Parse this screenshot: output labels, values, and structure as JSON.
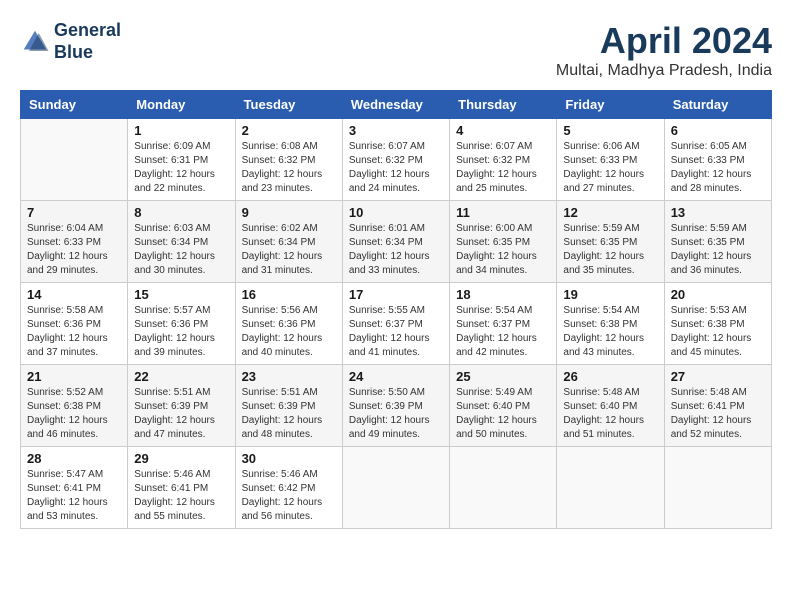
{
  "header": {
    "logo_line1": "General",
    "logo_line2": "Blue",
    "month_year": "April 2024",
    "location": "Multai, Madhya Pradesh, India"
  },
  "weekdays": [
    "Sunday",
    "Monday",
    "Tuesday",
    "Wednesday",
    "Thursday",
    "Friday",
    "Saturday"
  ],
  "weeks": [
    [
      null,
      {
        "day": 1,
        "sunrise": "6:09 AM",
        "sunset": "6:31 PM",
        "daylight": "12 hours and 22 minutes."
      },
      {
        "day": 2,
        "sunrise": "6:08 AM",
        "sunset": "6:32 PM",
        "daylight": "12 hours and 23 minutes."
      },
      {
        "day": 3,
        "sunrise": "6:07 AM",
        "sunset": "6:32 PM",
        "daylight": "12 hours and 24 minutes."
      },
      {
        "day": 4,
        "sunrise": "6:07 AM",
        "sunset": "6:32 PM",
        "daylight": "12 hours and 25 minutes."
      },
      {
        "day": 5,
        "sunrise": "6:06 AM",
        "sunset": "6:33 PM",
        "daylight": "12 hours and 27 minutes."
      },
      {
        "day": 6,
        "sunrise": "6:05 AM",
        "sunset": "6:33 PM",
        "daylight": "12 hours and 28 minutes."
      }
    ],
    [
      {
        "day": 7,
        "sunrise": "6:04 AM",
        "sunset": "6:33 PM",
        "daylight": "12 hours and 29 minutes."
      },
      {
        "day": 8,
        "sunrise": "6:03 AM",
        "sunset": "6:34 PM",
        "daylight": "12 hours and 30 minutes."
      },
      {
        "day": 9,
        "sunrise": "6:02 AM",
        "sunset": "6:34 PM",
        "daylight": "12 hours and 31 minutes."
      },
      {
        "day": 10,
        "sunrise": "6:01 AM",
        "sunset": "6:34 PM",
        "daylight": "12 hours and 33 minutes."
      },
      {
        "day": 11,
        "sunrise": "6:00 AM",
        "sunset": "6:35 PM",
        "daylight": "12 hours and 34 minutes."
      },
      {
        "day": 12,
        "sunrise": "5:59 AM",
        "sunset": "6:35 PM",
        "daylight": "12 hours and 35 minutes."
      },
      {
        "day": 13,
        "sunrise": "5:59 AM",
        "sunset": "6:35 PM",
        "daylight": "12 hours and 36 minutes."
      }
    ],
    [
      {
        "day": 14,
        "sunrise": "5:58 AM",
        "sunset": "6:36 PM",
        "daylight": "12 hours and 37 minutes."
      },
      {
        "day": 15,
        "sunrise": "5:57 AM",
        "sunset": "6:36 PM",
        "daylight": "12 hours and 39 minutes."
      },
      {
        "day": 16,
        "sunrise": "5:56 AM",
        "sunset": "6:36 PM",
        "daylight": "12 hours and 40 minutes."
      },
      {
        "day": 17,
        "sunrise": "5:55 AM",
        "sunset": "6:37 PM",
        "daylight": "12 hours and 41 minutes."
      },
      {
        "day": 18,
        "sunrise": "5:54 AM",
        "sunset": "6:37 PM",
        "daylight": "12 hours and 42 minutes."
      },
      {
        "day": 19,
        "sunrise": "5:54 AM",
        "sunset": "6:38 PM",
        "daylight": "12 hours and 43 minutes."
      },
      {
        "day": 20,
        "sunrise": "5:53 AM",
        "sunset": "6:38 PM",
        "daylight": "12 hours and 45 minutes."
      }
    ],
    [
      {
        "day": 21,
        "sunrise": "5:52 AM",
        "sunset": "6:38 PM",
        "daylight": "12 hours and 46 minutes."
      },
      {
        "day": 22,
        "sunrise": "5:51 AM",
        "sunset": "6:39 PM",
        "daylight": "12 hours and 47 minutes."
      },
      {
        "day": 23,
        "sunrise": "5:51 AM",
        "sunset": "6:39 PM",
        "daylight": "12 hours and 48 minutes."
      },
      {
        "day": 24,
        "sunrise": "5:50 AM",
        "sunset": "6:39 PM",
        "daylight": "12 hours and 49 minutes."
      },
      {
        "day": 25,
        "sunrise": "5:49 AM",
        "sunset": "6:40 PM",
        "daylight": "12 hours and 50 minutes."
      },
      {
        "day": 26,
        "sunrise": "5:48 AM",
        "sunset": "6:40 PM",
        "daylight": "12 hours and 51 minutes."
      },
      {
        "day": 27,
        "sunrise": "5:48 AM",
        "sunset": "6:41 PM",
        "daylight": "12 hours and 52 minutes."
      }
    ],
    [
      {
        "day": 28,
        "sunrise": "5:47 AM",
        "sunset": "6:41 PM",
        "daylight": "12 hours and 53 minutes."
      },
      {
        "day": 29,
        "sunrise": "5:46 AM",
        "sunset": "6:41 PM",
        "daylight": "12 hours and 55 minutes."
      },
      {
        "day": 30,
        "sunrise": "5:46 AM",
        "sunset": "6:42 PM",
        "daylight": "12 hours and 56 minutes."
      },
      null,
      null,
      null,
      null
    ]
  ],
  "row_shading": [
    "white",
    "shade",
    "white",
    "shade",
    "white"
  ]
}
